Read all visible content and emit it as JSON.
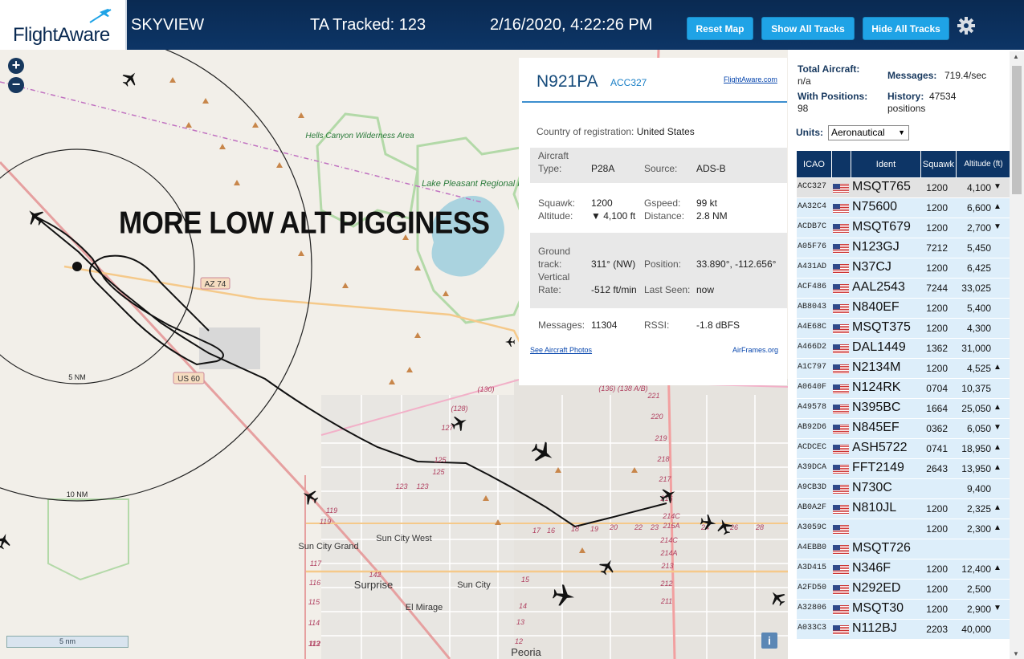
{
  "header": {
    "logo_text": "FlightAware",
    "app_title": "SKYVIEW",
    "tracked": "TA Tracked: 123",
    "datetime": "2/16/2020, 4:22:26 PM",
    "buttons": {
      "reset": "Reset Map",
      "show_all": "Show All Tracks",
      "hide_all": "Hide All Tracks"
    },
    "settings_icon": "gear-icon"
  },
  "map": {
    "annotation": "MORE LOW ALT PIGGINESS",
    "zoom_in": "+",
    "zoom_out": "−",
    "range_rings": [
      "5 NM",
      "10 NM"
    ],
    "scale_label": "5 nm",
    "info_label": "i",
    "places": [
      "Hells Canyon Wilderness Area",
      "Lake Pleasant Regional Park",
      "Sun City West",
      "Sun City Grand",
      "Surprise",
      "Sun City",
      "El Mirage",
      "Peoria"
    ],
    "road_shields": [
      "AZ 74",
      "US 60"
    ],
    "road_numbers": [
      "(130)",
      "(128)",
      "127",
      "(136) (138 A/B)",
      "221",
      "220",
      "219",
      "218",
      "217",
      "216",
      "214C",
      "215A",
      "214C",
      "214A",
      "213",
      "212",
      "211",
      "125",
      "125",
      "123",
      "123",
      "119",
      "119",
      "117",
      "116",
      "115",
      "114",
      "113",
      "112",
      "142",
      "15",
      "14",
      "13",
      "12",
      "17",
      "16",
      "18",
      "19",
      "20",
      "22",
      "23",
      "24",
      "26",
      "28"
    ]
  },
  "popup": {
    "registration": "N921PA",
    "icao": "ACC327",
    "fa_link": "FlightAware.com",
    "country_label": "Country of registration:",
    "country_value": "United States",
    "type_label": "Aircraft Type:",
    "type_label_1": "Aircraft",
    "type_label_2": "Type:",
    "type_value": "P28A",
    "source_label": "Source:",
    "source_value": "ADS-B",
    "squawk_label": "Squawk:",
    "squawk_value": "1200",
    "gspeed_label": "Gspeed:",
    "gspeed_value": "99 kt",
    "altitude_label": "Altitude:",
    "altitude_value": "▼ 4,100 ft",
    "distance_label": "Distance:",
    "distance_value": "2.8 NM",
    "track_label_1": "Ground",
    "track_label_2": "track:",
    "track_value": "311° (NW)",
    "position_label": "Position:",
    "position_value": "33.890°, -112.656°",
    "vrate_label_1": "Vertical",
    "vrate_label_2": "Rate:",
    "vrate_value": "-512 ft/min",
    "lastseen_label": "Last Seen:",
    "lastseen_value": "now",
    "messages_label": "Messages:",
    "messages_value": "11304",
    "rssi_label": "RSSI:",
    "rssi_value": "-1.8 dBFS",
    "photos_link": "See Aircraft Photos",
    "airframes_link": "AirFrames.org"
  },
  "sidebar": {
    "total_label": "Total Aircraft:",
    "total_value": "n/a",
    "messages_label": "Messages:",
    "messages_value": "719.4/sec",
    "positions_label": "With Positions:",
    "positions_value": "98",
    "history_label": "History:",
    "history_value": "47534",
    "history_unit": "positions",
    "units_label": "Units:",
    "units_value": "Aeronautical",
    "columns": [
      "ICAO",
      "",
      "Ident",
      "Squawk",
      "Altitude (ft)"
    ],
    "rows": [
      {
        "icao": "ACC327",
        "ident": "MSQT765",
        "squawk": "1200",
        "alt": "4,100",
        "trend": "▼",
        "sel": true
      },
      {
        "icao": "AA32C4",
        "ident": "N75600",
        "squawk": "1200",
        "alt": "6,600",
        "trend": "▲"
      },
      {
        "icao": "ACDB7C",
        "ident": "MSQT679",
        "squawk": "1200",
        "alt": "2,700",
        "trend": "▼"
      },
      {
        "icao": "A05F76",
        "ident": "N123GJ",
        "squawk": "7212",
        "alt": "5,450",
        "trend": ""
      },
      {
        "icao": "A431AD",
        "ident": "N37CJ",
        "squawk": "1200",
        "alt": "6,425",
        "trend": ""
      },
      {
        "icao": "ACF486",
        "ident": "AAL2543",
        "squawk": "7244",
        "alt": "33,025",
        "trend": ""
      },
      {
        "icao": "AB8043",
        "ident": "N840EF",
        "squawk": "1200",
        "alt": "5,400",
        "trend": ""
      },
      {
        "icao": "A4E68C",
        "ident": "MSQT375",
        "squawk": "1200",
        "alt": "4,300",
        "trend": ""
      },
      {
        "icao": "A466D2",
        "ident": "DAL1449",
        "squawk": "1362",
        "alt": "31,000",
        "trend": ""
      },
      {
        "icao": "A1C797",
        "ident": "N2134M",
        "squawk": "1200",
        "alt": "4,525",
        "trend": "▲"
      },
      {
        "icao": "A0640F",
        "ident": "N124RK",
        "squawk": "0704",
        "alt": "10,375",
        "trend": ""
      },
      {
        "icao": "A49578",
        "ident": "N395BC",
        "squawk": "1664",
        "alt": "25,050",
        "trend": "▲"
      },
      {
        "icao": "AB92D6",
        "ident": "N845EF",
        "squawk": "0362",
        "alt": "6,050",
        "trend": "▼"
      },
      {
        "icao": "ACDCEC",
        "ident": "ASH5722",
        "squawk": "0741",
        "alt": "18,950",
        "trend": "▲"
      },
      {
        "icao": "A39DCA",
        "ident": "FFT2149",
        "squawk": "2643",
        "alt": "13,950",
        "trend": "▲"
      },
      {
        "icao": "A9CB3D",
        "ident": "N730C",
        "squawk": "",
        "alt": "9,400",
        "trend": ""
      },
      {
        "icao": "AB0A2F",
        "ident": "N810JL",
        "squawk": "1200",
        "alt": "2,325",
        "trend": "▲"
      },
      {
        "icao": "A3059C",
        "ident": "",
        "squawk": "1200",
        "alt": "2,300",
        "trend": "▲"
      },
      {
        "icao": "A4EBB0",
        "ident": "MSQT726",
        "squawk": "",
        "alt": "",
        "trend": ""
      },
      {
        "icao": "A3D415",
        "ident": "N346F",
        "squawk": "1200",
        "alt": "12,400",
        "trend": "▲"
      },
      {
        "icao": "A2FD50",
        "ident": "N292ED",
        "squawk": "1200",
        "alt": "2,500",
        "trend": ""
      },
      {
        "icao": "A32806",
        "ident": "MSQT30",
        "squawk": "1200",
        "alt": "2,900",
        "trend": "▼"
      },
      {
        "icao": "A033C3",
        "ident": "N112BJ",
        "squawk": "2203",
        "alt": "40,000",
        "trend": ""
      }
    ]
  },
  "colors": {
    "header_bg": "#0d3566",
    "button": "#1fa3e6",
    "row_bg": "#ddeefa",
    "track": "#111111",
    "popup_rule": "#3d8fcf"
  }
}
